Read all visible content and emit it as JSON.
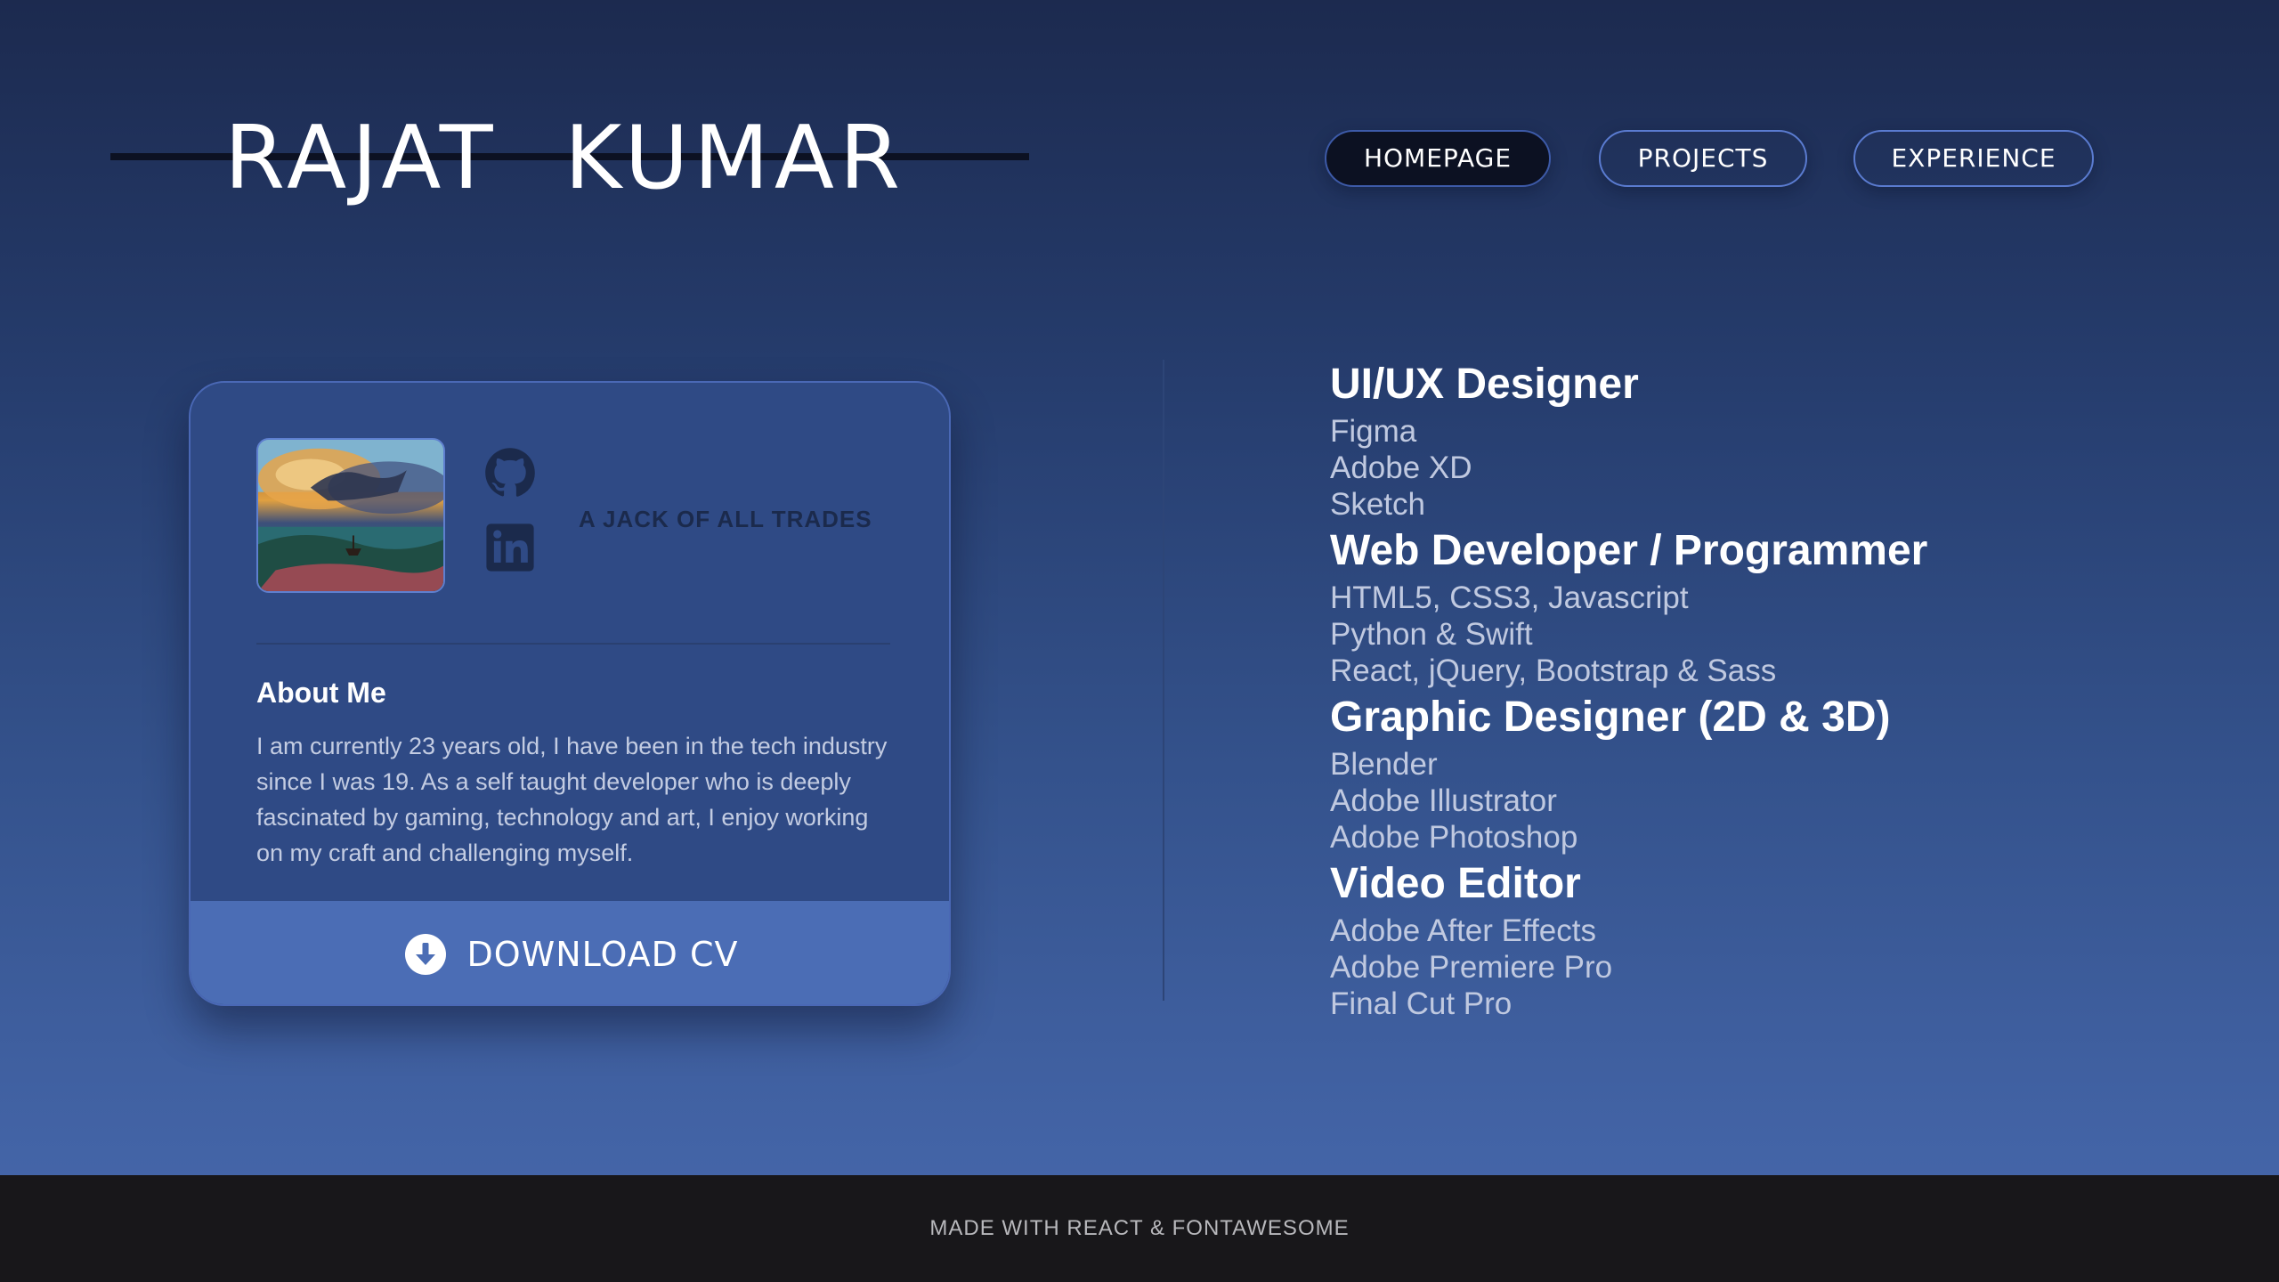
{
  "header": {
    "name": "RAJAT  KUMAR"
  },
  "nav": {
    "items": [
      {
        "label": "HOMEPAGE",
        "active": true
      },
      {
        "label": "PROJECTS",
        "active": false
      },
      {
        "label": "EXPERIENCE",
        "active": false
      }
    ]
  },
  "profile": {
    "tagline": "A JACK OF ALL TRADES",
    "social": [
      "github-icon",
      "linkedin-icon"
    ],
    "about_title": "About Me",
    "about_text": "I am currently 23 years old, I have been in the tech industry since I was 19. As a self taught developer who is deeply fascinated by gaming, technology and art, I enjoy working on my craft and challenging myself.",
    "download_label": "DOWNLOAD CV"
  },
  "skills": [
    {
      "title": "UI/UX Designer",
      "items": [
        "Figma",
        "Adobe XD",
        "Sketch"
      ]
    },
    {
      "title": "Web Developer / Programmer",
      "items": [
        "HTML5, CSS3, Javascript",
        "Python & Swift",
        "React, jQuery, Bootstrap & Sass"
      ]
    },
    {
      "title": "Graphic Designer (2D & 3D)",
      "items": [
        "Blender",
        "Adobe Illustrator",
        "Adobe Photoshop"
      ]
    },
    {
      "title": "Video Editor",
      "items": [
        "Adobe After Effects",
        "Adobe Premiere Pro",
        "Final Cut Pro"
      ]
    }
  ],
  "footer": {
    "text": "MADE WITH REACT & FONTAWESOME"
  },
  "colors": {
    "accent": "#4b6db5",
    "nav_active_bg": "#0c1122",
    "footer_bg": "#18171a"
  }
}
